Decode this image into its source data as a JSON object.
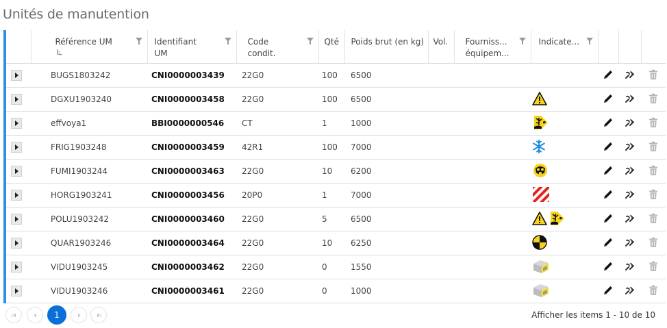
{
  "page": {
    "title": "Unités de manutention"
  },
  "columns": {
    "ref": "Référence UM",
    "id": "Identifiant UM",
    "code": "Code condit.",
    "qty": "Qté",
    "poids": "Poids brut (en kg)",
    "vol": "Vol.",
    "fourn": "Fourniss... équipem...",
    "ind": "Indicate..."
  },
  "rows": [
    {
      "ref": "BUGS1803242",
      "id": "CNI0000003439",
      "code": "22G0",
      "qty": "100",
      "poids": "6500",
      "indicators": []
    },
    {
      "ref": "DGXU1903240",
      "id": "CNI0000003458",
      "code": "22G0",
      "qty": "100",
      "poids": "6500",
      "indicators": [
        "warning-icon"
      ]
    },
    {
      "ref": "effvoya1",
      "id": "BBI0000000546",
      "code": "CT",
      "qty": "1",
      "poids": "1000",
      "indicators": [
        "pollutant-icon"
      ]
    },
    {
      "ref": "FRIG1903248",
      "id": "CNI0000003459",
      "code": "42R1",
      "qty": "100",
      "poids": "7000",
      "indicators": [
        "snowflake-icon"
      ]
    },
    {
      "ref": "FUMI1903244",
      "id": "CNI0000003463",
      "code": "22G0",
      "qty": "10",
      "poids": "6200",
      "indicators": [
        "gas-mask-icon"
      ]
    },
    {
      "ref": "HORG1903241",
      "id": "CNI0000003456",
      "code": "20P0",
      "qty": "1",
      "poids": "7000",
      "indicators": [
        "oversize-stripes-icon"
      ]
    },
    {
      "ref": "POLU1903242",
      "id": "CNI0000003460",
      "code": "22G0",
      "qty": "5",
      "poids": "6500",
      "indicators": [
        "warning-icon",
        "pollutant-icon"
      ]
    },
    {
      "ref": "QUAR1903246",
      "id": "CNI0000003464",
      "code": "22G0",
      "qty": "10",
      "poids": "6250",
      "indicators": [
        "quarantine-icon"
      ]
    },
    {
      "ref": "VIDU1903245",
      "id": "CNI0000003462",
      "code": "22G0",
      "qty": "0",
      "poids": "1550",
      "indicators": [
        "empty-container-icon"
      ]
    },
    {
      "ref": "VIDU1903246",
      "id": "CNI0000003461",
      "code": "22G0",
      "qty": "0",
      "poids": "1000",
      "indicators": [
        "empty-container-icon"
      ]
    }
  ],
  "pager": {
    "current_page": "1",
    "info": "Afficher les items 1 - 10 de 10"
  },
  "colors": {
    "accent": "#2a91e8",
    "active_page": "#0a6fd6",
    "warning": "#f5d31c",
    "snow": "#1b8de0",
    "stripe_red": "#e8201d"
  }
}
